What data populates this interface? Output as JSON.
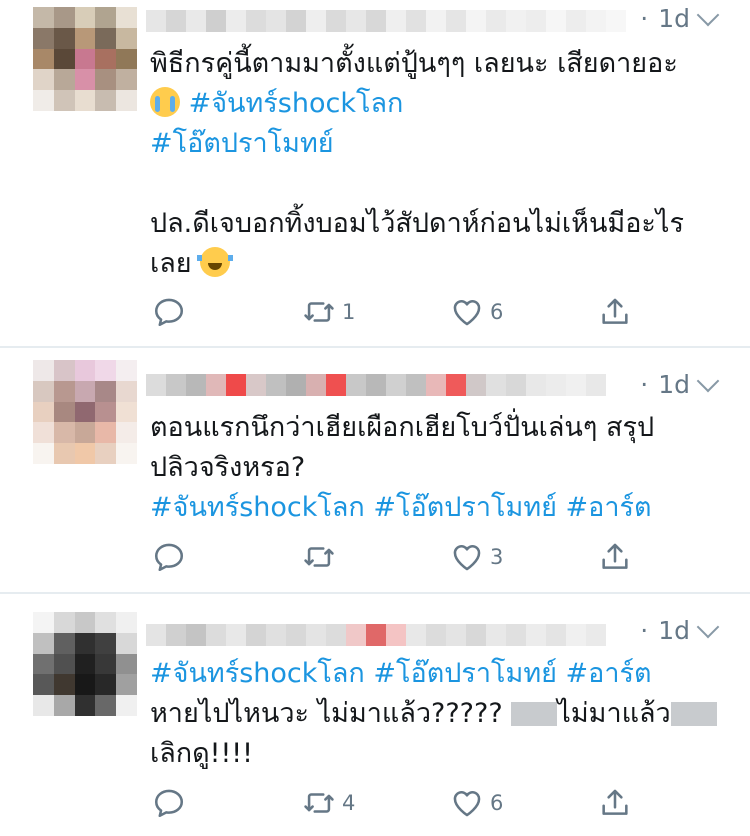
{
  "tweets": [
    {
      "time": "1d",
      "lines": [
        [
          {
            "t": "พิธีกรคู่นี้ตามมาตั้งแต่ปู้นๆๆ เลยนะ เสียดายอะ",
            "c": "text"
          }
        ],
        [
          {
            "e": "sob"
          },
          {
            "t": " #จันทร์shockโลก",
            "c": "tag"
          }
        ],
        [
          {
            "t": "#โอ๊ตปราโมทย์",
            "c": "tag"
          }
        ],
        [],
        [
          {
            "t": "ปล.ดีเจบอกทิ้งบอมไว้สัปดาห์ก่อนไม่เห็นมีอะไร",
            "c": "text"
          }
        ],
        [
          {
            "t": "เลย ",
            "c": "text"
          },
          {
            "e": "joy"
          }
        ]
      ],
      "reply_count": "",
      "retweet_count": "1",
      "like_count": "6"
    },
    {
      "time": "1d",
      "lines": [
        [
          {
            "t": "ตอนแรกนึกว่าเฮียเผือกเฮียโบว์ปั่นเล่นๆ สรุป",
            "c": "text"
          }
        ],
        [
          {
            "t": "ปลิวจริงหรอ?",
            "c": "text"
          }
        ],
        [
          {
            "t": "#จันทร์shockโลก #โอ๊ตปราโมทย์ #อาร์ต",
            "c": "tag"
          }
        ]
      ],
      "reply_count": "",
      "retweet_count": "",
      "like_count": "3"
    },
    {
      "time": "1d",
      "lines": [
        [
          {
            "t": "#จันทร์shockโลก #โอ๊ตปราโมทย์ #อาร์ต",
            "c": "tag"
          }
        ],
        [
          {
            "t": "หายไปไหนวะ ไม่มาแล้ว????? ",
            "c": "text"
          },
          {
            "b": 1
          },
          {
            "t": "ไม่มาแล้ว",
            "c": "text"
          },
          {
            "b": 1
          }
        ],
        [
          {
            "t": "เลิกดู!!!!",
            "c": "text"
          }
        ]
      ],
      "reply_count": "",
      "retweet_count": "4",
      "like_count": "6"
    }
  ],
  "colors": {
    "hashtag": "#1b95e0",
    "meta": "#657786",
    "divider": "#e6ecf0"
  },
  "icons": [
    "reply-icon",
    "retweet-icon",
    "like-icon",
    "share-icon",
    "chevron-down-icon"
  ]
}
